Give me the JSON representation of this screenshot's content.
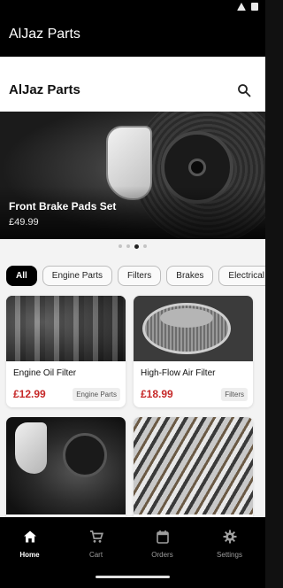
{
  "app": {
    "window_title": "AlJaz Parts",
    "header_title": "AlJaz Parts"
  },
  "icons": {
    "search": "search-icon",
    "home": "home-icon",
    "cart": "cart-icon",
    "orders": "calendar-icon",
    "settings": "gear-icon"
  },
  "carousel": {
    "slide_title": "Front Brake Pads Set",
    "slide_price": "£49.99",
    "dot_count": 4,
    "active_dot": 2
  },
  "filters": [
    {
      "label": "All",
      "active": true
    },
    {
      "label": "Engine Parts",
      "active": false
    },
    {
      "label": "Filters",
      "active": false
    },
    {
      "label": "Brakes",
      "active": false
    },
    {
      "label": "Electrical",
      "active": false
    }
  ],
  "products": [
    {
      "name": "Engine Oil Filter",
      "price": "£12.99",
      "category": "Engine Parts"
    },
    {
      "name": "High-Flow Air Filter",
      "price": "£18.99",
      "category": "Filters"
    },
    {
      "name": "",
      "price": "",
      "category": ""
    },
    {
      "name": "",
      "price": "",
      "category": ""
    }
  ],
  "nav": {
    "items": [
      {
        "label": "Home",
        "active": true
      },
      {
        "label": "Cart",
        "active": false
      },
      {
        "label": "Orders",
        "active": false
      },
      {
        "label": "Settings",
        "active": false
      }
    ]
  },
  "colors": {
    "accent": "#000000",
    "price": "#c62828",
    "background": "#f3f3f3"
  }
}
